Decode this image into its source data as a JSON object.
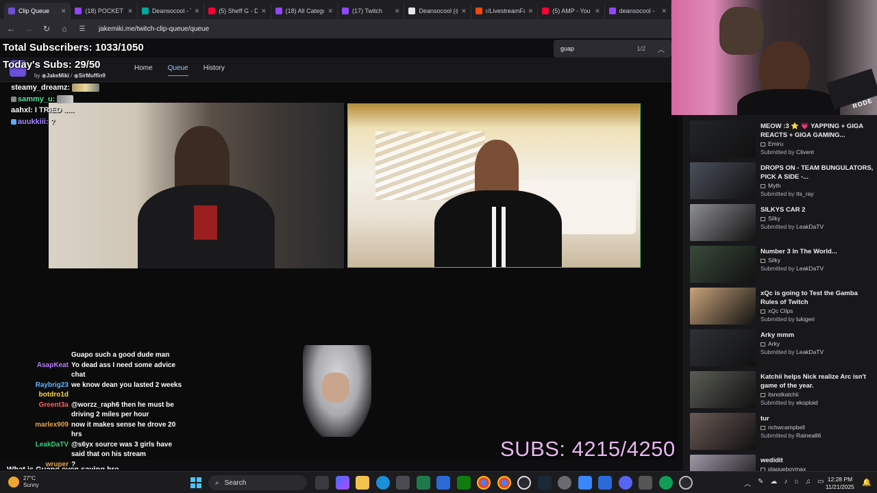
{
  "browser": {
    "tabs": [
      {
        "label": "Clip Queue",
        "color": "#6b4fd8",
        "active": true
      },
      {
        "label": "(18) POCKET W",
        "color": "#9146ff"
      },
      {
        "label": "Deansocool - T",
        "color": "#00a7a0"
      },
      {
        "label": "(5) Sheff G - D",
        "color": "#ff0033"
      },
      {
        "label": "(18) All Catego",
        "color": "#9146ff"
      },
      {
        "label": "(17) Twitch",
        "color": "#9146ff"
      },
      {
        "label": "Deansocool (@",
        "color": "#e7e7e7"
      },
      {
        "label": "r/LivestreamFa",
        "color": "#ff4500"
      },
      {
        "label": "(5) AMP - You",
        "color": "#ff0033"
      },
      {
        "label": "deansocool -",
        "color": "#9146ff"
      }
    ],
    "url": "jakemiki.me/twitch-clip-queue/queue",
    "find": {
      "query": "guap",
      "count": "1/2"
    }
  },
  "overlay": {
    "total_subs": "Total Subscribers: 1033/1050",
    "today_subs": "Today's Subs: 29/50",
    "subs_big": "SUBS: 4215/4250"
  },
  "site": {
    "credits_prefix": "by",
    "author1": "JakeMiki",
    "author2": "SirMuffin9",
    "nav": [
      "Home",
      "Queue",
      "History"
    ]
  },
  "chat_top": [
    {
      "user": "steamy_dreamz:",
      "text": ""
    },
    {
      "user": "sammy_u:",
      "text": ""
    },
    {
      "user": "aahxl:",
      "text": "I TRIED ....."
    },
    {
      "user": "auukkiii:",
      "text": "?"
    }
  ],
  "chat": [
    {
      "user": "",
      "text": "Guapo such a good dude man",
      "color": "#ff4d4d"
    },
    {
      "user": "AsapKeat",
      "text": "Yo dead ass I need some advice chat",
      "color": "#b57cff"
    },
    {
      "user": "Raybrig23",
      "text": "we know dean you lasted 2 weeks",
      "color": "#5db7ff"
    },
    {
      "user": "botdro1d",
      "text": "",
      "color": "#ffd84a"
    },
    {
      "user": "Greent3a",
      "text": "@worzz_raph6 then he must be driving 2 miles per hour",
      "color": "#ff5e5e"
    },
    {
      "user": "marlex909",
      "text": "now it makes sense he drove 20 hrs",
      "color": "#e8a34a"
    },
    {
      "user": "LeakDaTV",
      "text": "@s6yx source was 3 girls have said that on his stream",
      "color": "#36d17c"
    },
    {
      "user": "wruper",
      "text": "?",
      "color": "#e8a34a"
    }
  ],
  "chat_footer": "What is Guapo even saying bro",
  "clips": [
    {
      "title": "MEOW :3 ⭐ 💗 YAPPING + GIGA REACTS + GIGA GAMING...",
      "channel": "Emiru",
      "submitter": "Clivent",
      "thumb": "#222428"
    },
    {
      "title": "DROPS ON - TEAM BUNGULATORS, PICK A SIDE -...",
      "channel": "Myth",
      "submitter": "Its_ray",
      "thumb": "#4a4f5a"
    },
    {
      "title": "SILKYS CAR 2",
      "channel": "Silky",
      "submitter": "LeakDaTV",
      "thumb": "#8e8f92"
    },
    {
      "title": "Number 3 In The World...",
      "channel": "Silky",
      "submitter": "LeakDaTV",
      "thumb": "#3a4a3a"
    },
    {
      "title": "xQc is going to Test the Gamba Rules of Twitch",
      "channel": "xQc Clips",
      "submitter": "lukigeri",
      "thumb": "#c9a47a"
    },
    {
      "title": "Arky mmm",
      "channel": "Arky",
      "submitter": "LeakDaTV",
      "thumb": "#2e3136"
    },
    {
      "title": "Katchii helps Nick realize Arc isn't game of the year.",
      "channel": "itsnotkatchii",
      "submitter": "ekoploid",
      "thumb": "#5a5d55"
    },
    {
      "title": "tur",
      "channel": "richwcampbell",
      "submitter": "Rainea86",
      "thumb": "#6a5a55"
    },
    {
      "title": "wedidit",
      "channel": "plagueboymax",
      "submitter": "",
      "thumb": "#a09aa8"
    }
  ],
  "clip_submitted_prefix": "Submitted by",
  "taskbar": {
    "temp": "27°C",
    "weather": "Sunny",
    "search": "Search",
    "time": "12:28 PM",
    "date": "11/21/2025"
  },
  "webcam": {
    "mic_brand": "RODE"
  }
}
